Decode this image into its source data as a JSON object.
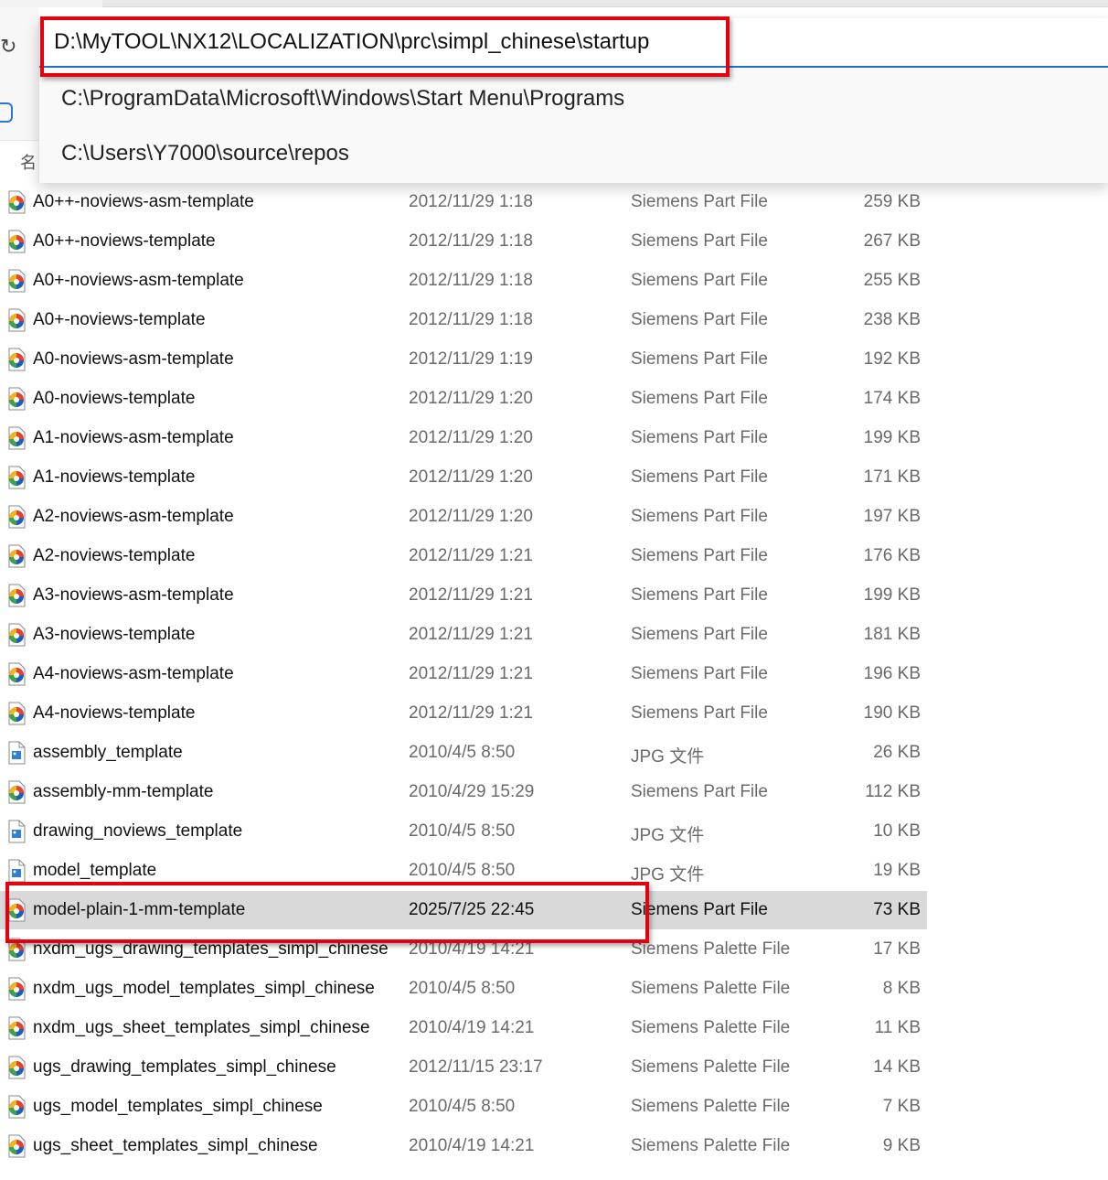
{
  "address_bar": {
    "path": "D:\\MyTOOL\\NX12\\LOCALIZATION\\prc\\simpl_chinese\\startup",
    "suggestions": [
      "C:\\ProgramData\\Microsoft\\Windows\\Start Menu\\Programs",
      "C:\\Users\\Y7000\\source\\repos"
    ]
  },
  "list_header": {
    "name_label": "名"
  },
  "colors": {
    "highlight": "#e3000f",
    "selected_row": "#d9d9d9",
    "accent": "#1f6fd1"
  },
  "files": [
    {
      "name": "A0++-noviews-asm-template",
      "date": "2012/11/29 1:18",
      "type": "Siemens Part File",
      "size": "259 KB",
      "icon": "siemens-part-icon"
    },
    {
      "name": "A0++-noviews-template",
      "date": "2012/11/29 1:18",
      "type": "Siemens Part File",
      "size": "267 KB",
      "icon": "siemens-part-icon"
    },
    {
      "name": "A0+-noviews-asm-template",
      "date": "2012/11/29 1:18",
      "type": "Siemens Part File",
      "size": "255 KB",
      "icon": "siemens-part-icon"
    },
    {
      "name": "A0+-noviews-template",
      "date": "2012/11/29 1:18",
      "type": "Siemens Part File",
      "size": "238 KB",
      "icon": "siemens-part-icon"
    },
    {
      "name": "A0-noviews-asm-template",
      "date": "2012/11/29 1:19",
      "type": "Siemens Part File",
      "size": "192 KB",
      "icon": "siemens-part-icon"
    },
    {
      "name": "A0-noviews-template",
      "date": "2012/11/29 1:20",
      "type": "Siemens Part File",
      "size": "174 KB",
      "icon": "siemens-part-icon"
    },
    {
      "name": "A1-noviews-asm-template",
      "date": "2012/11/29 1:20",
      "type": "Siemens Part File",
      "size": "199 KB",
      "icon": "siemens-part-icon"
    },
    {
      "name": "A1-noviews-template",
      "date": "2012/11/29 1:20",
      "type": "Siemens Part File",
      "size": "171 KB",
      "icon": "siemens-part-icon"
    },
    {
      "name": "A2-noviews-asm-template",
      "date": "2012/11/29 1:20",
      "type": "Siemens Part File",
      "size": "197 KB",
      "icon": "siemens-part-icon"
    },
    {
      "name": "A2-noviews-template",
      "date": "2012/11/29 1:21",
      "type": "Siemens Part File",
      "size": "176 KB",
      "icon": "siemens-part-icon"
    },
    {
      "name": "A3-noviews-asm-template",
      "date": "2012/11/29 1:21",
      "type": "Siemens Part File",
      "size": "199 KB",
      "icon": "siemens-part-icon"
    },
    {
      "name": "A3-noviews-template",
      "date": "2012/11/29 1:21",
      "type": "Siemens Part File",
      "size": "181 KB",
      "icon": "siemens-part-icon"
    },
    {
      "name": "A4-noviews-asm-template",
      "date": "2012/11/29 1:21",
      "type": "Siemens Part File",
      "size": "196 KB",
      "icon": "siemens-part-icon"
    },
    {
      "name": "A4-noviews-template",
      "date": "2012/11/29 1:21",
      "type": "Siemens Part File",
      "size": "190 KB",
      "icon": "siemens-part-icon"
    },
    {
      "name": "assembly_template",
      "date": "2010/4/5 8:50",
      "type": "JPG 文件",
      "size": "26 KB",
      "icon": "image-file-icon"
    },
    {
      "name": "assembly-mm-template",
      "date": "2010/4/29 15:29",
      "type": "Siemens Part File",
      "size": "112 KB",
      "icon": "siemens-part-icon"
    },
    {
      "name": "drawing_noviews_template",
      "date": "2010/4/5 8:50",
      "type": "JPG 文件",
      "size": "10 KB",
      "icon": "image-file-icon"
    },
    {
      "name": "model_template",
      "date": "2010/4/5 8:50",
      "type": "JPG 文件",
      "size": "19 KB",
      "icon": "image-file-icon"
    },
    {
      "name": "model-plain-1-mm-template",
      "date": "2025/7/25 22:45",
      "type": "Siemens Part File",
      "size": "73 KB",
      "icon": "siemens-part-icon",
      "selected": true
    },
    {
      "name": "nxdm_ugs_drawing_templates_simpl_chinese",
      "date": "2010/4/19 14:21",
      "type": "Siemens Palette File",
      "size": "17 KB",
      "icon": "siemens-part-icon"
    },
    {
      "name": "nxdm_ugs_model_templates_simpl_chinese",
      "date": "2010/4/5 8:50",
      "type": "Siemens Palette File",
      "size": "8 KB",
      "icon": "siemens-part-icon"
    },
    {
      "name": "nxdm_ugs_sheet_templates_simpl_chinese",
      "date": "2010/4/19 14:21",
      "type": "Siemens Palette File",
      "size": "11 KB",
      "icon": "siemens-part-icon"
    },
    {
      "name": "ugs_drawing_templates_simpl_chinese",
      "date": "2012/11/15 23:17",
      "type": "Siemens Palette File",
      "size": "14 KB",
      "icon": "siemens-part-icon"
    },
    {
      "name": "ugs_model_templates_simpl_chinese",
      "date": "2010/4/5 8:50",
      "type": "Siemens Palette File",
      "size": "7 KB",
      "icon": "siemens-part-icon"
    },
    {
      "name": "ugs_sheet_templates_simpl_chinese",
      "date": "2010/4/19 14:21",
      "type": "Siemens Palette File",
      "size": "9 KB",
      "icon": "siemens-part-icon"
    }
  ]
}
